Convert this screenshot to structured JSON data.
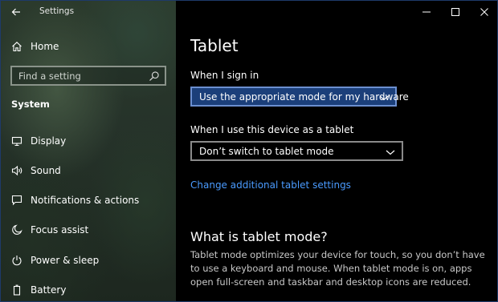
{
  "window": {
    "title": "Settings"
  },
  "sidebar": {
    "home_label": "Home",
    "search": {
      "placeholder": "Find a setting",
      "value": ""
    },
    "section_heading": "System",
    "items": [
      {
        "label": "Display",
        "icon": "monitor-icon"
      },
      {
        "label": "Sound",
        "icon": "speaker-icon"
      },
      {
        "label": "Notifications & actions",
        "icon": "notification-icon"
      },
      {
        "label": "Focus assist",
        "icon": "moon-icon"
      },
      {
        "label": "Power & sleep",
        "icon": "power-icon"
      },
      {
        "label": "Battery",
        "icon": "battery-icon"
      }
    ]
  },
  "main": {
    "title": "Tablet",
    "sign_in": {
      "label": "When I sign in",
      "selected": "Use the appropriate mode for my hardware"
    },
    "tablet_use": {
      "label": "When I use this device as a tablet",
      "selected": "Don’t switch to tablet mode"
    },
    "link": "Change additional tablet settings",
    "about": {
      "heading": "What is tablet mode?",
      "body": "Tablet mode optimizes your device for touch, so you don’t have to use a keyboard and mouse. When tablet mode is on, apps open full-screen and taskbar and desktop icons are reduced."
    }
  },
  "colors": {
    "accent_link": "#4a9bff",
    "dropdown_selected_bg": "#1b3f7a",
    "window_border": "#1e3a6a"
  }
}
